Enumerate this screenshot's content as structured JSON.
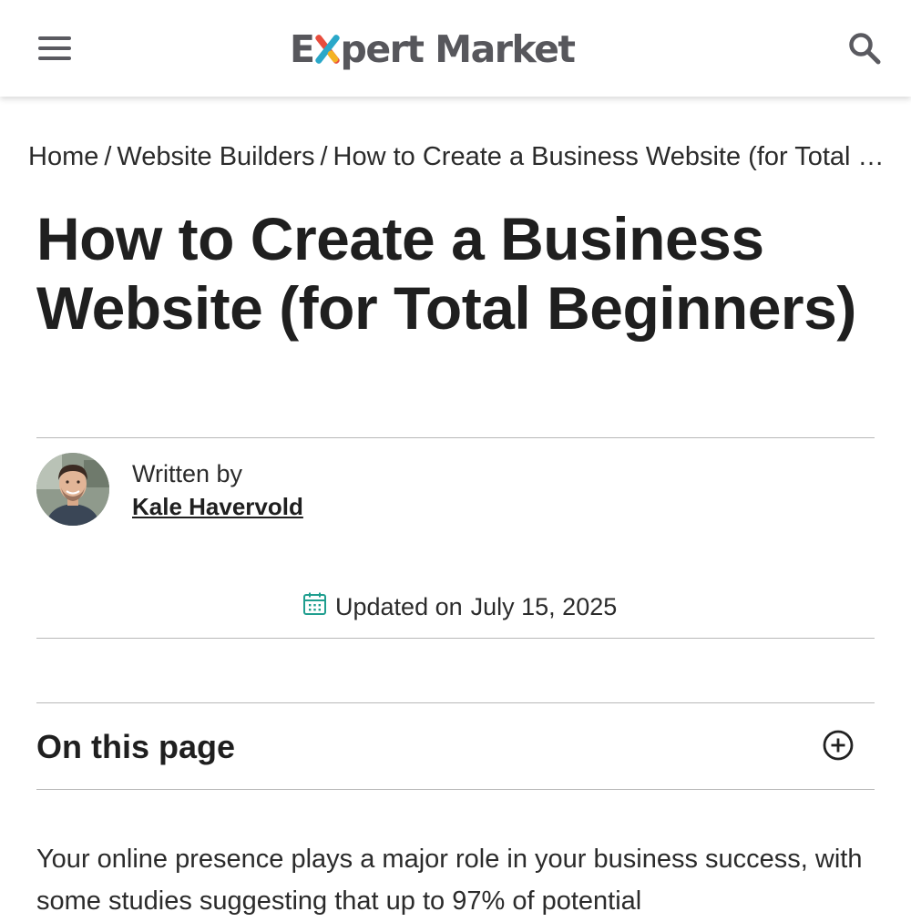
{
  "header": {
    "logo_text_pre": "E",
    "logo_text_post": "pert Market",
    "menu_icon": "hamburger-menu-icon",
    "search_icon": "search-icon"
  },
  "breadcrumb": {
    "items": [
      "Home",
      "Website Builders",
      "How to Create a Business Website (for Total Beginners)"
    ],
    "separator": "/"
  },
  "article": {
    "title": "How to Create a Business Website (for Total Beginners)",
    "written_by_label": "Written by",
    "author": "Kale Havervold",
    "updated_label": "Updated on",
    "updated_date": "July 15, 2025"
  },
  "toc": {
    "title": "On this page",
    "toggle_icon": "plus-circle-icon"
  },
  "intro": "Your online presence plays a major role in your business success, with some studies suggesting that up to 97% of potential",
  "colors": {
    "logo_gray": "#57575c",
    "logo_red": "#e84d3d",
    "logo_blue": "#2aa8c9",
    "logo_yellow": "#f4b324",
    "calendar_teal": "#1f9e8f",
    "text": "#222222",
    "rule": "#b8b8b8"
  }
}
